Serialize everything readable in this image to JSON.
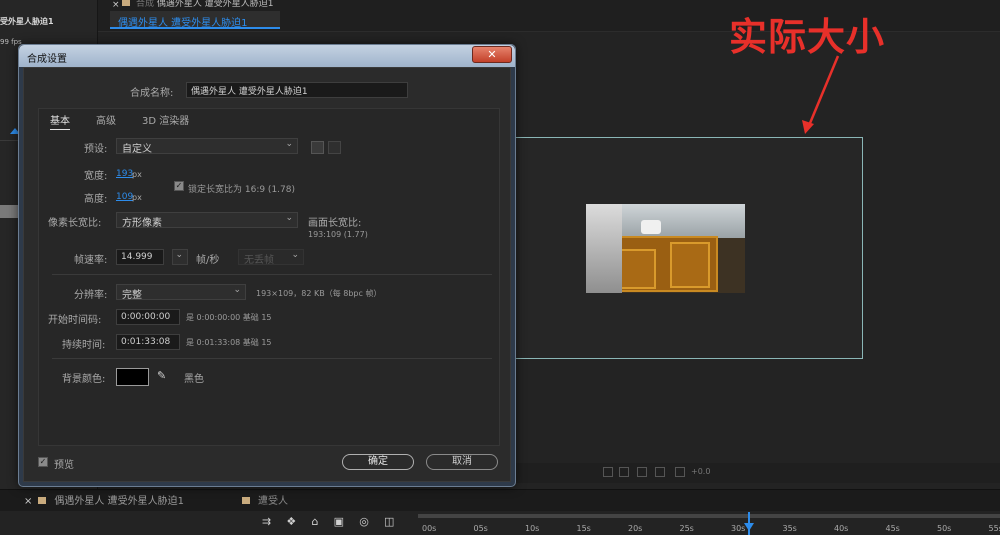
{
  "background": {
    "project_comp_name": "受外星人胁迫1",
    "project_fps": "99 fps",
    "comp_tab_top": "偶遇外星人 遭受外星人胁迫1",
    "comp_tab_top_prefix": "合成",
    "comp_tab_active": "偶遇外星人 遭受外星人胁迫1",
    "annotation": "实际大小",
    "toolbar_zoom": "+0.0",
    "timeline_tab1": "偶遇外星人 遭受外星人胁迫1",
    "timeline_tab2": "遭受人",
    "ruler_labels": [
      "00s",
      "05s",
      "10s",
      "15s",
      "20s",
      "25s",
      "30s",
      "35s",
      "40s",
      "45s",
      "50s",
      "55s"
    ]
  },
  "dialog": {
    "title": "合成设置",
    "close": "✕",
    "name_label": "合成名称:",
    "name_value": "偶遇外星人 遭受外星人胁迫1",
    "tabs": [
      "基本",
      "高级",
      "3D 渲染器"
    ],
    "preset_label": "预设:",
    "preset_value": "自定义",
    "width_label": "宽度:",
    "width_value": "193",
    "height_label": "高度:",
    "height_value": "109",
    "unit_px": "px",
    "lock_aspect_label": "锁定长宽比为 16:9 (1.78)",
    "pixel_aspect_label": "像素长宽比:",
    "pixel_aspect_value": "方形像素",
    "frame_aspect_label": "画面长宽比:",
    "frame_aspect_value": "193:109 (1.77)",
    "fps_label": "帧速率:",
    "fps_value": "14.999",
    "fps_unit": "帧/秒",
    "drop_frame": "无丢帧",
    "resolution_label": "分辨率:",
    "resolution_value": "完整",
    "resolution_info": "193×109，82 KB（每 8bpc 帧）",
    "start_tc_label": "开始时间码:",
    "start_tc_value": "0:00:00:00",
    "start_tc_info": "是 0:00:00:00  基础 15",
    "duration_label": "持续时间:",
    "duration_value": "0:01:33:08",
    "duration_info": "是 0:01:33:08  基础 15",
    "bg_color_label": "背景颜色:",
    "bg_color_name": "黑色",
    "preview_label": "预览",
    "ok_label": "确定",
    "cancel_label": "取消"
  },
  "colors": {
    "accent_blue": "#2d8ceb",
    "annotation_red": "#e8302a",
    "bg_color": "#000000"
  }
}
